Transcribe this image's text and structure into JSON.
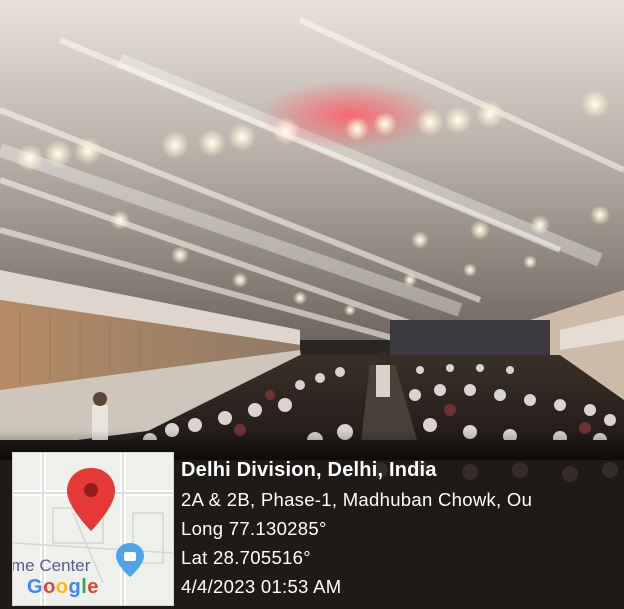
{
  "geotag": {
    "title": "Delhi Division, Delhi, India",
    "address": "2A & 2B, Phase-1, Madhuban Chowk, Ou",
    "longitude": "Long 77.130285°",
    "latitude": "Lat 28.705516°",
    "datetime": "4/4/2023 01:53 AM"
  },
  "map": {
    "place_label": "me Center",
    "logo_letters": [
      "G",
      "o",
      "o",
      "g",
      "l",
      "e"
    ],
    "pin_color": "#E53935",
    "place_pin_color": "#4FA3E8"
  }
}
